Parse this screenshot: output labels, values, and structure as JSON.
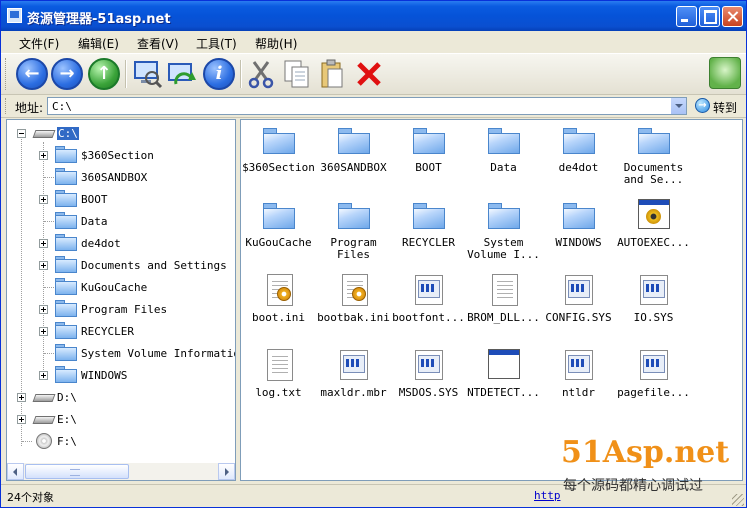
{
  "window": {
    "title": "资源管理器-51asp.net"
  },
  "menu": {
    "items": [
      {
        "label": "文件(F)"
      },
      {
        "label": "编辑(E)"
      },
      {
        "label": "查看(V)"
      },
      {
        "label": "工具(T)"
      },
      {
        "label": "帮助(H)"
      }
    ]
  },
  "toolbar": {
    "buttons": [
      {
        "icon": "back-icon"
      },
      {
        "icon": "forward-icon"
      },
      {
        "icon": "up-icon"
      },
      {
        "icon": "search-computer-icon"
      },
      {
        "icon": "refresh-icon"
      },
      {
        "icon": "info-icon"
      },
      {
        "icon": "cut-icon"
      },
      {
        "icon": "copy-icon"
      },
      {
        "icon": "paste-icon"
      },
      {
        "icon": "delete-icon"
      }
    ]
  },
  "address": {
    "label": "地址:",
    "value": "C:\\",
    "go_label": "转到"
  },
  "tree": {
    "nodes": [
      {
        "label": "C:\\",
        "selected": true
      },
      {
        "label": "$360Section"
      },
      {
        "label": "360SANDBOX"
      },
      {
        "label": "BOOT"
      },
      {
        "label": "Data"
      },
      {
        "label": "de4dot"
      },
      {
        "label": "Documents and Settings"
      },
      {
        "label": "KuGouCache"
      },
      {
        "label": "Program Files"
      },
      {
        "label": "RECYCLER"
      },
      {
        "label": "System Volume Information"
      },
      {
        "label": "WINDOWS"
      },
      {
        "label": "D:\\"
      },
      {
        "label": "E:\\"
      },
      {
        "label": "F:\\"
      }
    ]
  },
  "files": [
    {
      "label": "$360Section",
      "type": "folder"
    },
    {
      "label": "360SANDBOX",
      "type": "folder"
    },
    {
      "label": "BOOT",
      "type": "folder"
    },
    {
      "label": "Data",
      "type": "folder"
    },
    {
      "label": "de4dot",
      "type": "folder"
    },
    {
      "label": "Documents and Se...",
      "type": "folder"
    },
    {
      "label": "KuGouCache",
      "type": "folder"
    },
    {
      "label": "Program Files",
      "type": "folder"
    },
    {
      "label": "RECYCLER",
      "type": "folder"
    },
    {
      "label": "System Volume I...",
      "type": "folder"
    },
    {
      "label": "WINDOWS",
      "type": "folder"
    },
    {
      "label": "AUTOEXEC...",
      "type": "batch"
    },
    {
      "label": "boot.ini",
      "type": "config"
    },
    {
      "label": "bootbak.ini",
      "type": "config"
    },
    {
      "label": "bootfont...",
      "type": "system"
    },
    {
      "label": "BROM_DLL...",
      "type": "text"
    },
    {
      "label": "CONFIG.SYS",
      "type": "system"
    },
    {
      "label": "IO.SYS",
      "type": "system"
    },
    {
      "label": "log.txt",
      "type": "text"
    },
    {
      "label": "maxldr.mbr",
      "type": "system"
    },
    {
      "label": "MSDOS.SYS",
      "type": "system"
    },
    {
      "label": "NTDETECT...",
      "type": "exe"
    },
    {
      "label": "ntldr",
      "type": "system"
    },
    {
      "label": "pagefile...",
      "type": "system"
    }
  ],
  "status": {
    "count": "24个对象",
    "url": "http"
  },
  "watermark": {
    "brand": "51Asp.net",
    "tagline": "每个源码都精心调试过"
  },
  "colors": {
    "titlebar": "#0653d8",
    "selection": "#316ac5",
    "watermark": "#f09018"
  }
}
